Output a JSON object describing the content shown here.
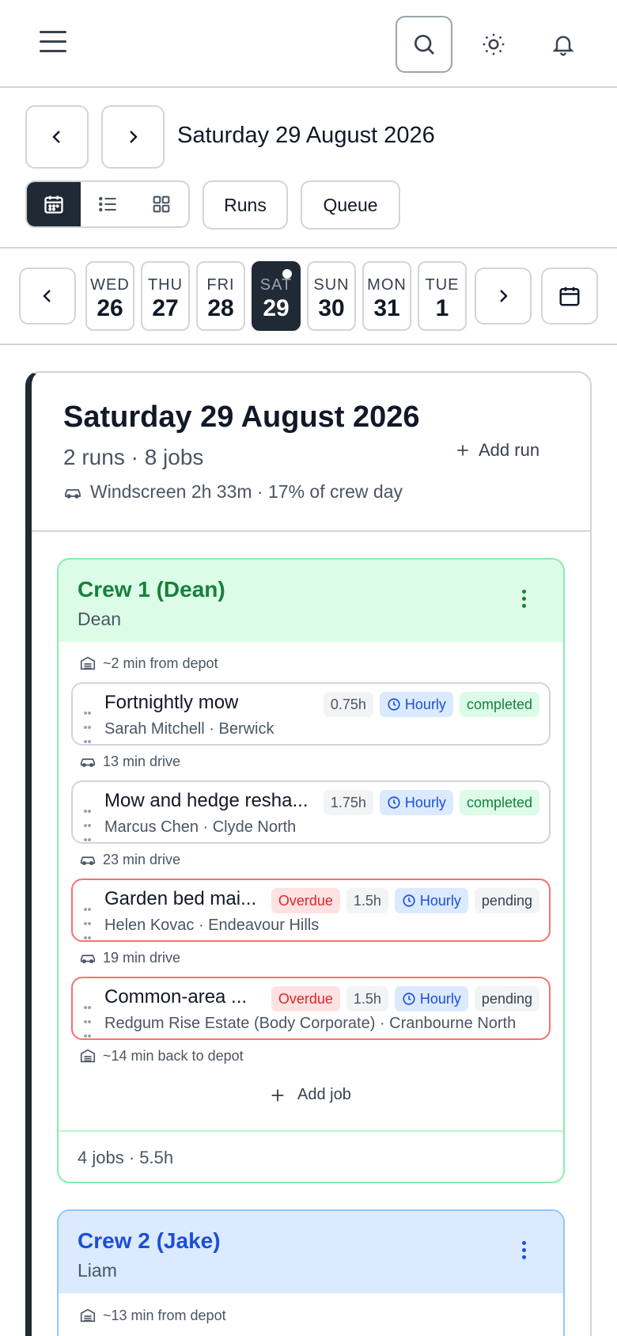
{
  "header": {
    "menu_icon": "hamburger-icon",
    "search_icon": "search-icon",
    "theme_icon": "sun-icon",
    "notifications_icon": "bell-icon"
  },
  "datebar": {
    "title": "Saturday 29 August 2026",
    "views": [
      "calendar-view",
      "list-view",
      "grid-view"
    ],
    "active_view": "calendar-view",
    "runs_label": "Runs",
    "queue_label": "Queue"
  },
  "week": [
    {
      "dow": "WED",
      "day": "26",
      "active": false
    },
    {
      "dow": "THU",
      "day": "27",
      "active": false
    },
    {
      "dow": "FRI",
      "day": "28",
      "active": false
    },
    {
      "dow": "SAT",
      "day": "29",
      "active": true
    },
    {
      "dow": "SUN",
      "day": "30",
      "active": false
    },
    {
      "dow": "MON",
      "day": "31",
      "active": false
    },
    {
      "dow": "TUE",
      "day": "1",
      "active": false
    }
  ],
  "day_card": {
    "title": "Saturday 29 August 2026",
    "summary": "2 runs · 8 jobs",
    "windscreen": "Windscreen 2h 33m · 17% of crew day",
    "add_run_label": "Add run"
  },
  "crews": [
    {
      "name": "Crew 1 (Dean)",
      "leader": "Dean",
      "start_travel": "~2 min from depot",
      "jobs": [
        {
          "title": "Fortnightly mow",
          "sub": "Sarah Mitchell · Berwick",
          "overdue": false,
          "hours": "0.75h",
          "rate": "Hourly",
          "status": "completed",
          "travel_after": "13 min drive"
        },
        {
          "title": "Mow and hedge resha...",
          "sub": "Marcus Chen · Clyde North",
          "overdue": false,
          "hours": "1.75h",
          "rate": "Hourly",
          "status": "completed",
          "travel_after": "23 min drive"
        },
        {
          "title": "Garden bed mai...",
          "sub": "Helen Kovac · Endeavour Hills",
          "overdue": true,
          "overdue_label": "Overdue",
          "hours": "1.5h",
          "rate": "Hourly",
          "status": "pending",
          "travel_after": "19 min drive"
        },
        {
          "title": "Common-area ...",
          "sub": "Redgum Rise Estate (Body Corporate) · Cranbourne North",
          "overdue": true,
          "overdue_label": "Overdue",
          "hours": "1.5h",
          "rate": "Hourly",
          "status": "pending",
          "travel_after": "~14 min back to depot"
        }
      ],
      "add_job_label": "Add job",
      "footer": "4 jobs · 5.5h"
    },
    {
      "name": "Crew 2 (Jake)",
      "leader": "Liam",
      "start_travel": "~13 min from depot"
    }
  ],
  "colors": {
    "dark": "#1f2a35",
    "green": "#15803d",
    "blue": "#1d4ed8",
    "red": "#dc2626"
  }
}
